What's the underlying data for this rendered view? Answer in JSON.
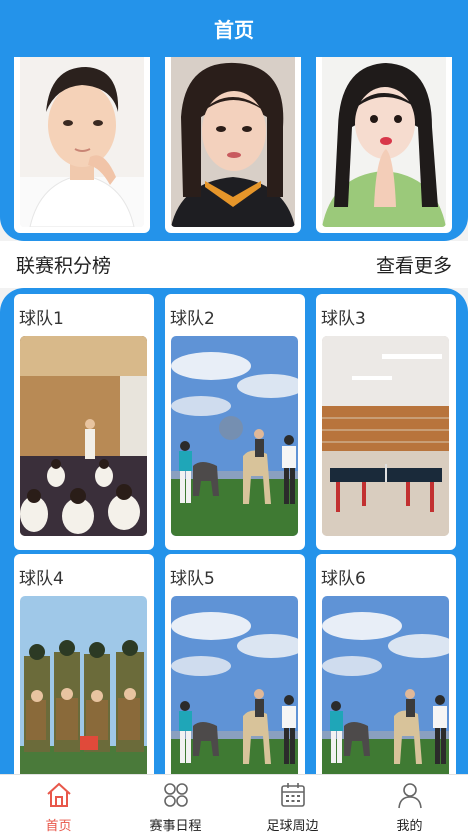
{
  "header": {
    "title": "首页"
  },
  "banner": {
    "photos": [
      {
        "icon": "portrait-young-man-photo"
      },
      {
        "icon": "portrait-young-woman-photo"
      },
      {
        "icon": "portrait-girl-green-sweater-photo"
      }
    ]
  },
  "league": {
    "title": "联赛积分榜",
    "more_label": "查看更多"
  },
  "teams": [
    {
      "name": "球队1",
      "photo": "indoor-group-activity-photo"
    },
    {
      "name": "球队2",
      "photo": "horse-riding-group-photo"
    },
    {
      "name": "球队3",
      "photo": "table-tennis-hall-photo"
    },
    {
      "name": "球队4",
      "photo": "military-camp-group-photo"
    },
    {
      "name": "球队5",
      "photo": "horse-riding-group-photo"
    },
    {
      "name": "球队6",
      "photo": "horse-riding-group-photo"
    }
  ],
  "tabbar": {
    "items": [
      {
        "label": "首页",
        "icon": "home-icon",
        "active": true
      },
      {
        "label": "赛事日程",
        "icon": "grid-flower-icon",
        "active": false
      },
      {
        "label": "足球周边",
        "icon": "calendar-icon",
        "active": false
      },
      {
        "label": "我的",
        "icon": "user-icon",
        "active": false
      }
    ]
  },
  "colors": {
    "brand_blue": "#2493ea",
    "active_tab": "#e8574a"
  }
}
